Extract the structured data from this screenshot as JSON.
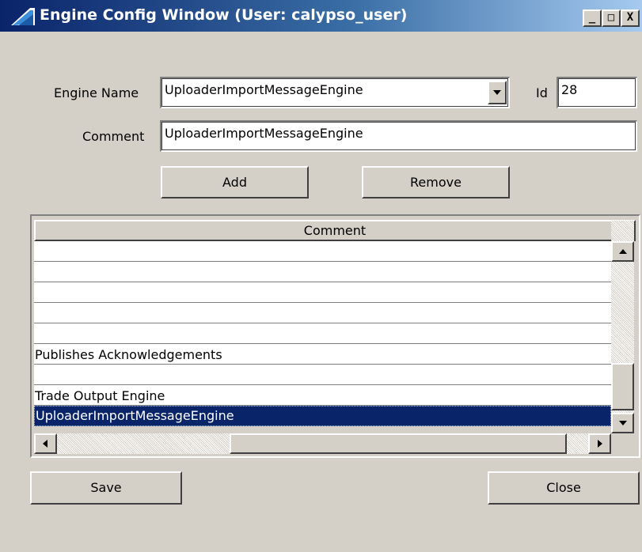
{
  "window": {
    "title": "Engine Config Window (User: calypso_user)",
    "minimize_glyph": "_",
    "maximize_glyph": "□",
    "close_glyph": "X"
  },
  "form": {
    "engine_name_label": "Engine Name",
    "engine_name_value": "UploaderImportMessageEngine",
    "id_label": "Id",
    "id_value": "28",
    "comment_label": "Comment",
    "comment_value": "UploaderImportMessageEngine"
  },
  "buttons": {
    "add": "Add",
    "remove": "Remove",
    "save": "Save",
    "close": "Close"
  },
  "table": {
    "column_header": "Comment",
    "rows": [
      "",
      "",
      "",
      "",
      "",
      "Publishes Acknowledgements",
      "",
      "Trade Output Engine",
      "UploaderImportMessageEngine"
    ],
    "selected_row": 8
  },
  "colors": {
    "titlebar_start": "#0a246a",
    "titlebar_end": "#a6caf0",
    "window_bg": "#d4d0c8",
    "selection_bg": "#0a246a"
  }
}
